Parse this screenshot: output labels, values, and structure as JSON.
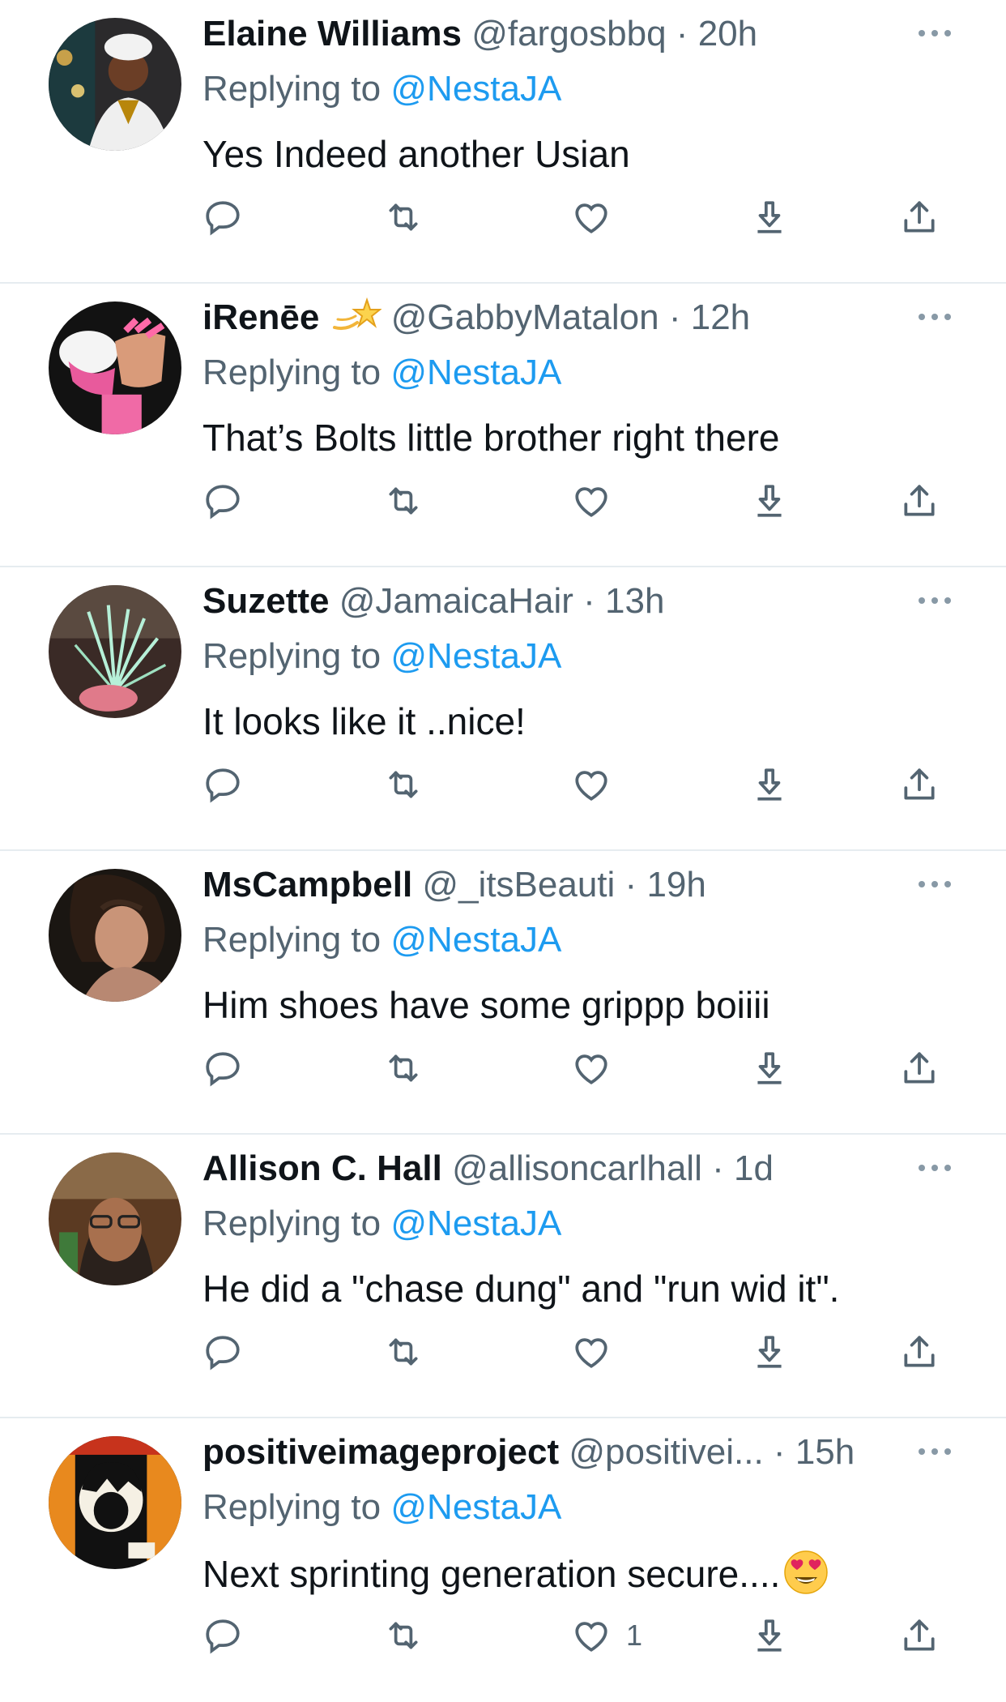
{
  "colors": {
    "text": "#0f1419",
    "secondary": "#536471",
    "link": "#1d9bf0",
    "divider": "#e6ecf0"
  },
  "tweets": [
    {
      "name": "Elaine Williams",
      "handle": "@fargosbbq",
      "sep": "·",
      "time": "20h",
      "replying_prefix": "Replying to",
      "mention": "@NestaJA",
      "text": "Yes Indeed another Usian",
      "likes": ""
    },
    {
      "name": "iRenēe",
      "name_emoji": "dizzy-star",
      "handle": "@GabbyMatalon",
      "sep": "·",
      "time": "12h",
      "replying_prefix": "Replying to",
      "mention": "@NestaJA",
      "text": "That’s Bolts little brother right there",
      "likes": ""
    },
    {
      "name": "Suzette",
      "handle": "@JamaicaHair",
      "sep": "·",
      "time": "13h",
      "replying_prefix": "Replying to",
      "mention": "@NestaJA",
      "text": "It looks like it ..nice!",
      "likes": ""
    },
    {
      "name": "MsCampbell",
      "handle": "@_itsBeauti",
      "sep": "·",
      "time": "19h",
      "replying_prefix": "Replying to",
      "mention": "@NestaJA",
      "text": "Him shoes have some grippp boiiii",
      "likes": ""
    },
    {
      "name": "Allison C. Hall",
      "handle": "@allisoncarlhall",
      "sep": "·",
      "time": "1d",
      "replying_prefix": "Replying to",
      "mention": "@NestaJA",
      "text": "He did a \"chase dung\" and \"run wid it\".",
      "likes": ""
    },
    {
      "name": "positiveimageproject",
      "handle": "@positivei...",
      "sep": "·",
      "time": "15h",
      "replying_prefix": "Replying to",
      "mention": "@NestaJA",
      "text": "Next sprinting generation secure....",
      "text_emoji": "heart-eyes-emoji",
      "likes": "1"
    }
  ],
  "icons": {
    "reply": "reply-icon",
    "retweet": "retweet-icon",
    "like": "heart-icon",
    "download": "download-icon",
    "share": "share-icon",
    "more": "more-icon"
  }
}
